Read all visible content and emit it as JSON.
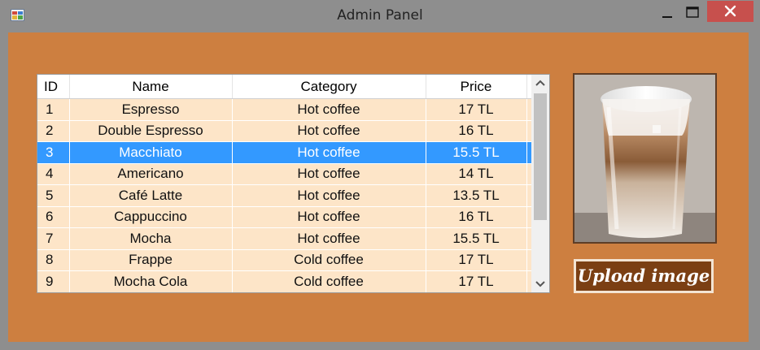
{
  "window": {
    "title": "Admin Panel",
    "icons": {
      "app": "app-icon",
      "minimize": "minimize-icon",
      "maximize": "maximize-icon",
      "close": "close-icon"
    }
  },
  "grid": {
    "columns": [
      "ID",
      "Name",
      "Category",
      "Price"
    ],
    "rows": [
      [
        "1",
        "Espresso",
        "Hot coffee",
        "17 TL"
      ],
      [
        "2",
        "Double Espresso",
        "Hot coffee",
        "16 TL"
      ],
      [
        "3",
        "Macchiato",
        "Hot coffee",
        "15.5 TL"
      ],
      [
        "4",
        "Americano",
        "Hot coffee",
        "14 TL"
      ],
      [
        "5",
        "Café Latte",
        "Hot coffee",
        "13.5 TL"
      ],
      [
        "6",
        "Cappuccino",
        "Hot coffee",
        "16 TL"
      ],
      [
        "7",
        "Mocha",
        "Hot coffee",
        "15.5 TL"
      ],
      [
        "8",
        "Frappe",
        "Cold coffee",
        "17 TL"
      ],
      [
        "9",
        "Mocha Cola",
        "Cold coffee",
        "17 TL"
      ]
    ],
    "selected_row": 2
  },
  "image_panel": {
    "image": "latte-macchiato-glass",
    "upload_label": "Upload image"
  },
  "colors": {
    "client_background": "#cd7f40",
    "row_background": "#fde5c8",
    "selected_row": "#3399ff",
    "button_background": "#7b3f13",
    "close_button": "#c7504d"
  }
}
